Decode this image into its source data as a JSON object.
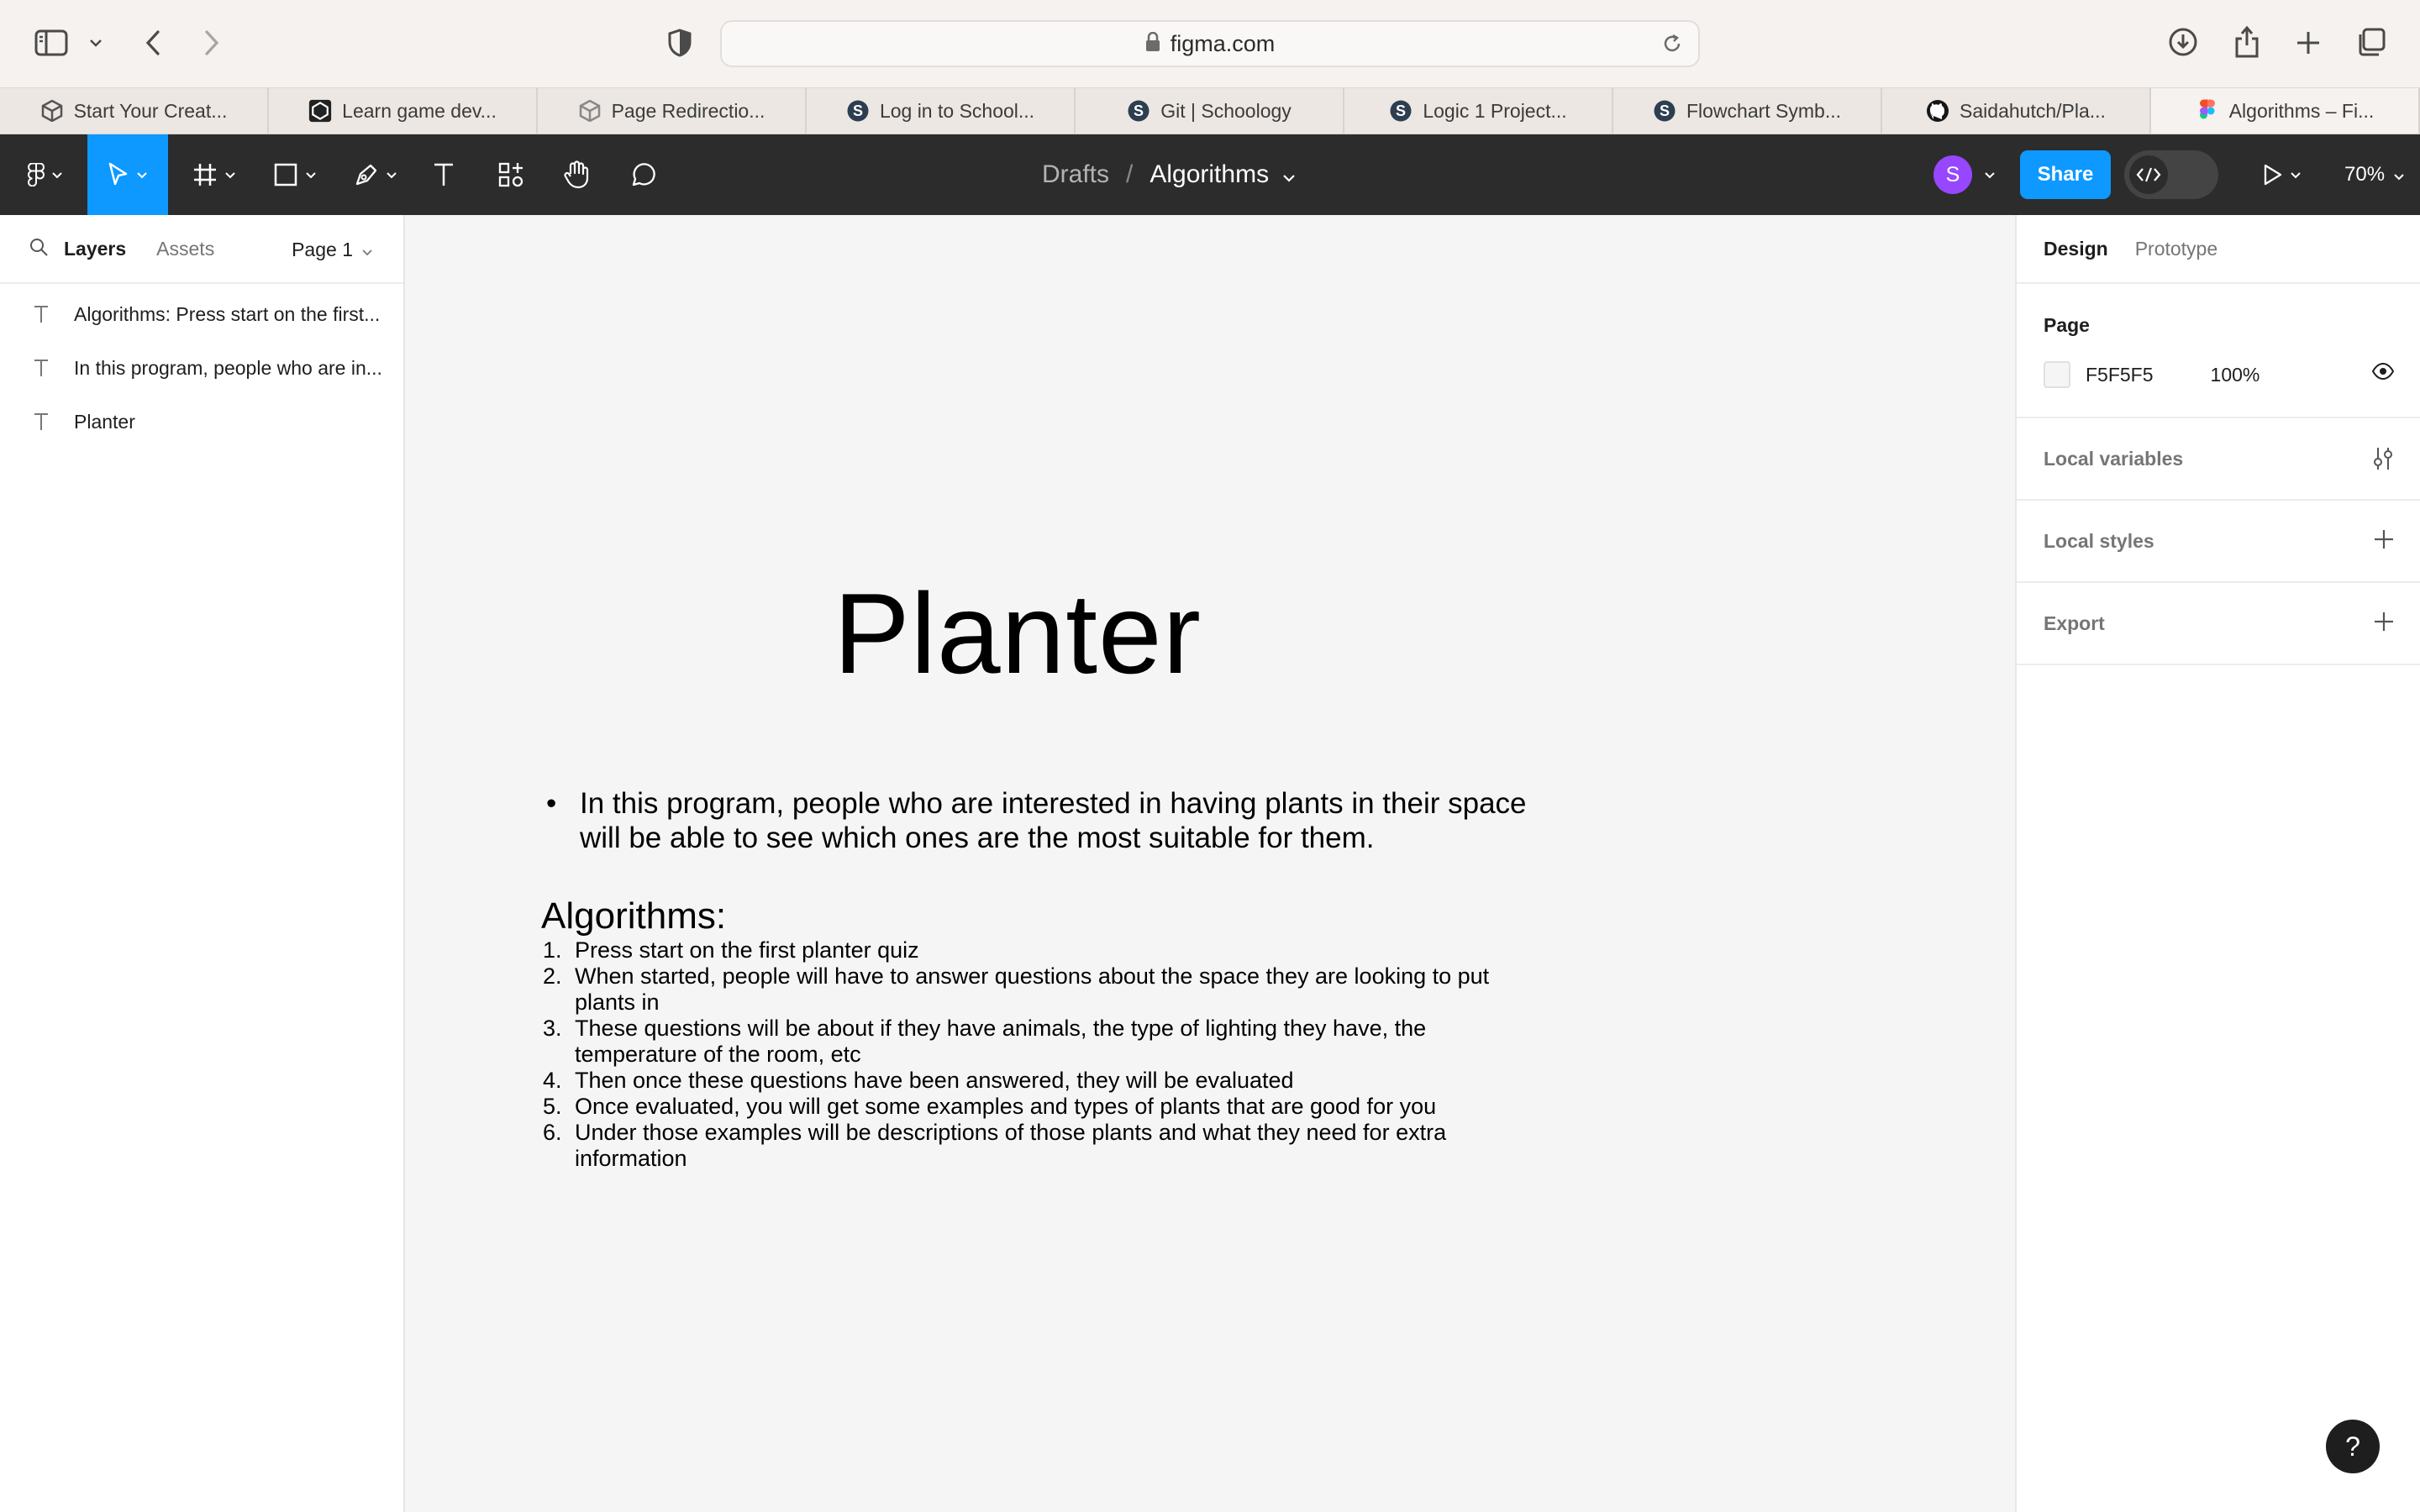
{
  "browser": {
    "url": "figma.com",
    "tabs": [
      {
        "title": "Start Your Creat...",
        "icon": "unity-icon"
      },
      {
        "title": "Learn game dev...",
        "icon": "unity-learn-icon"
      },
      {
        "title": "Page Redirectio...",
        "icon": "unity-icon"
      },
      {
        "title": "Log in to School...",
        "icon": "schoology-icon"
      },
      {
        "title": "Git | Schoology",
        "icon": "schoology-icon"
      },
      {
        "title": "Logic 1 Project...",
        "icon": "schoology-icon"
      },
      {
        "title": "Flowchart Symb...",
        "icon": "schoology-icon"
      },
      {
        "title": "Saidahutch/Pla...",
        "icon": "github-icon"
      },
      {
        "title": "Algorithms – Fi...",
        "icon": "figma-icon",
        "active": true
      }
    ]
  },
  "toolbar": {
    "breadcrumb_drafts": "Drafts",
    "breadcrumb_sep": "/",
    "file_name": "Algorithms",
    "avatar_initial": "S",
    "share_label": "Share",
    "zoom": "70%"
  },
  "left_panel": {
    "tab_layers": "Layers",
    "tab_assets": "Assets",
    "page_select": "Page 1",
    "layers": [
      {
        "name": "Algorithms: Press start on the first..."
      },
      {
        "name": "In this program, people who are in..."
      },
      {
        "name": "Planter"
      }
    ]
  },
  "canvas": {
    "title": "Planter",
    "intro_bullet": "In this program, people who are interested in having plants in their space will be able to see which ones are the most suitable for them.",
    "algorithms_heading": "Algorithms:",
    "algorithm_steps": [
      "Press start on the first planter quiz",
      "When started, people will have to answer questions about the space they are looking to put plants in",
      "These questions will be about if they have animals, the type of lighting they have, the temperature of the room, etc",
      "Then once these questions have been answered, they will be evaluated",
      "Once evaluated, you will get some examples and types of plants that are good for you",
      "Under those examples will be descriptions of those plants and what they need for extra information"
    ]
  },
  "right_panel": {
    "tab_design": "Design",
    "tab_prototype": "Prototype",
    "page_title": "Page",
    "page_fill_hex": "F5F5F5",
    "page_fill_opacity": "100%",
    "local_variables": "Local variables",
    "local_styles": "Local styles",
    "export": "Export",
    "help": "?"
  },
  "colors": {
    "accent": "#0d99ff",
    "toolbar_bg": "#2c2c2c",
    "avatar": "#9747ff",
    "canvas_bg": "#f5f5f5"
  }
}
